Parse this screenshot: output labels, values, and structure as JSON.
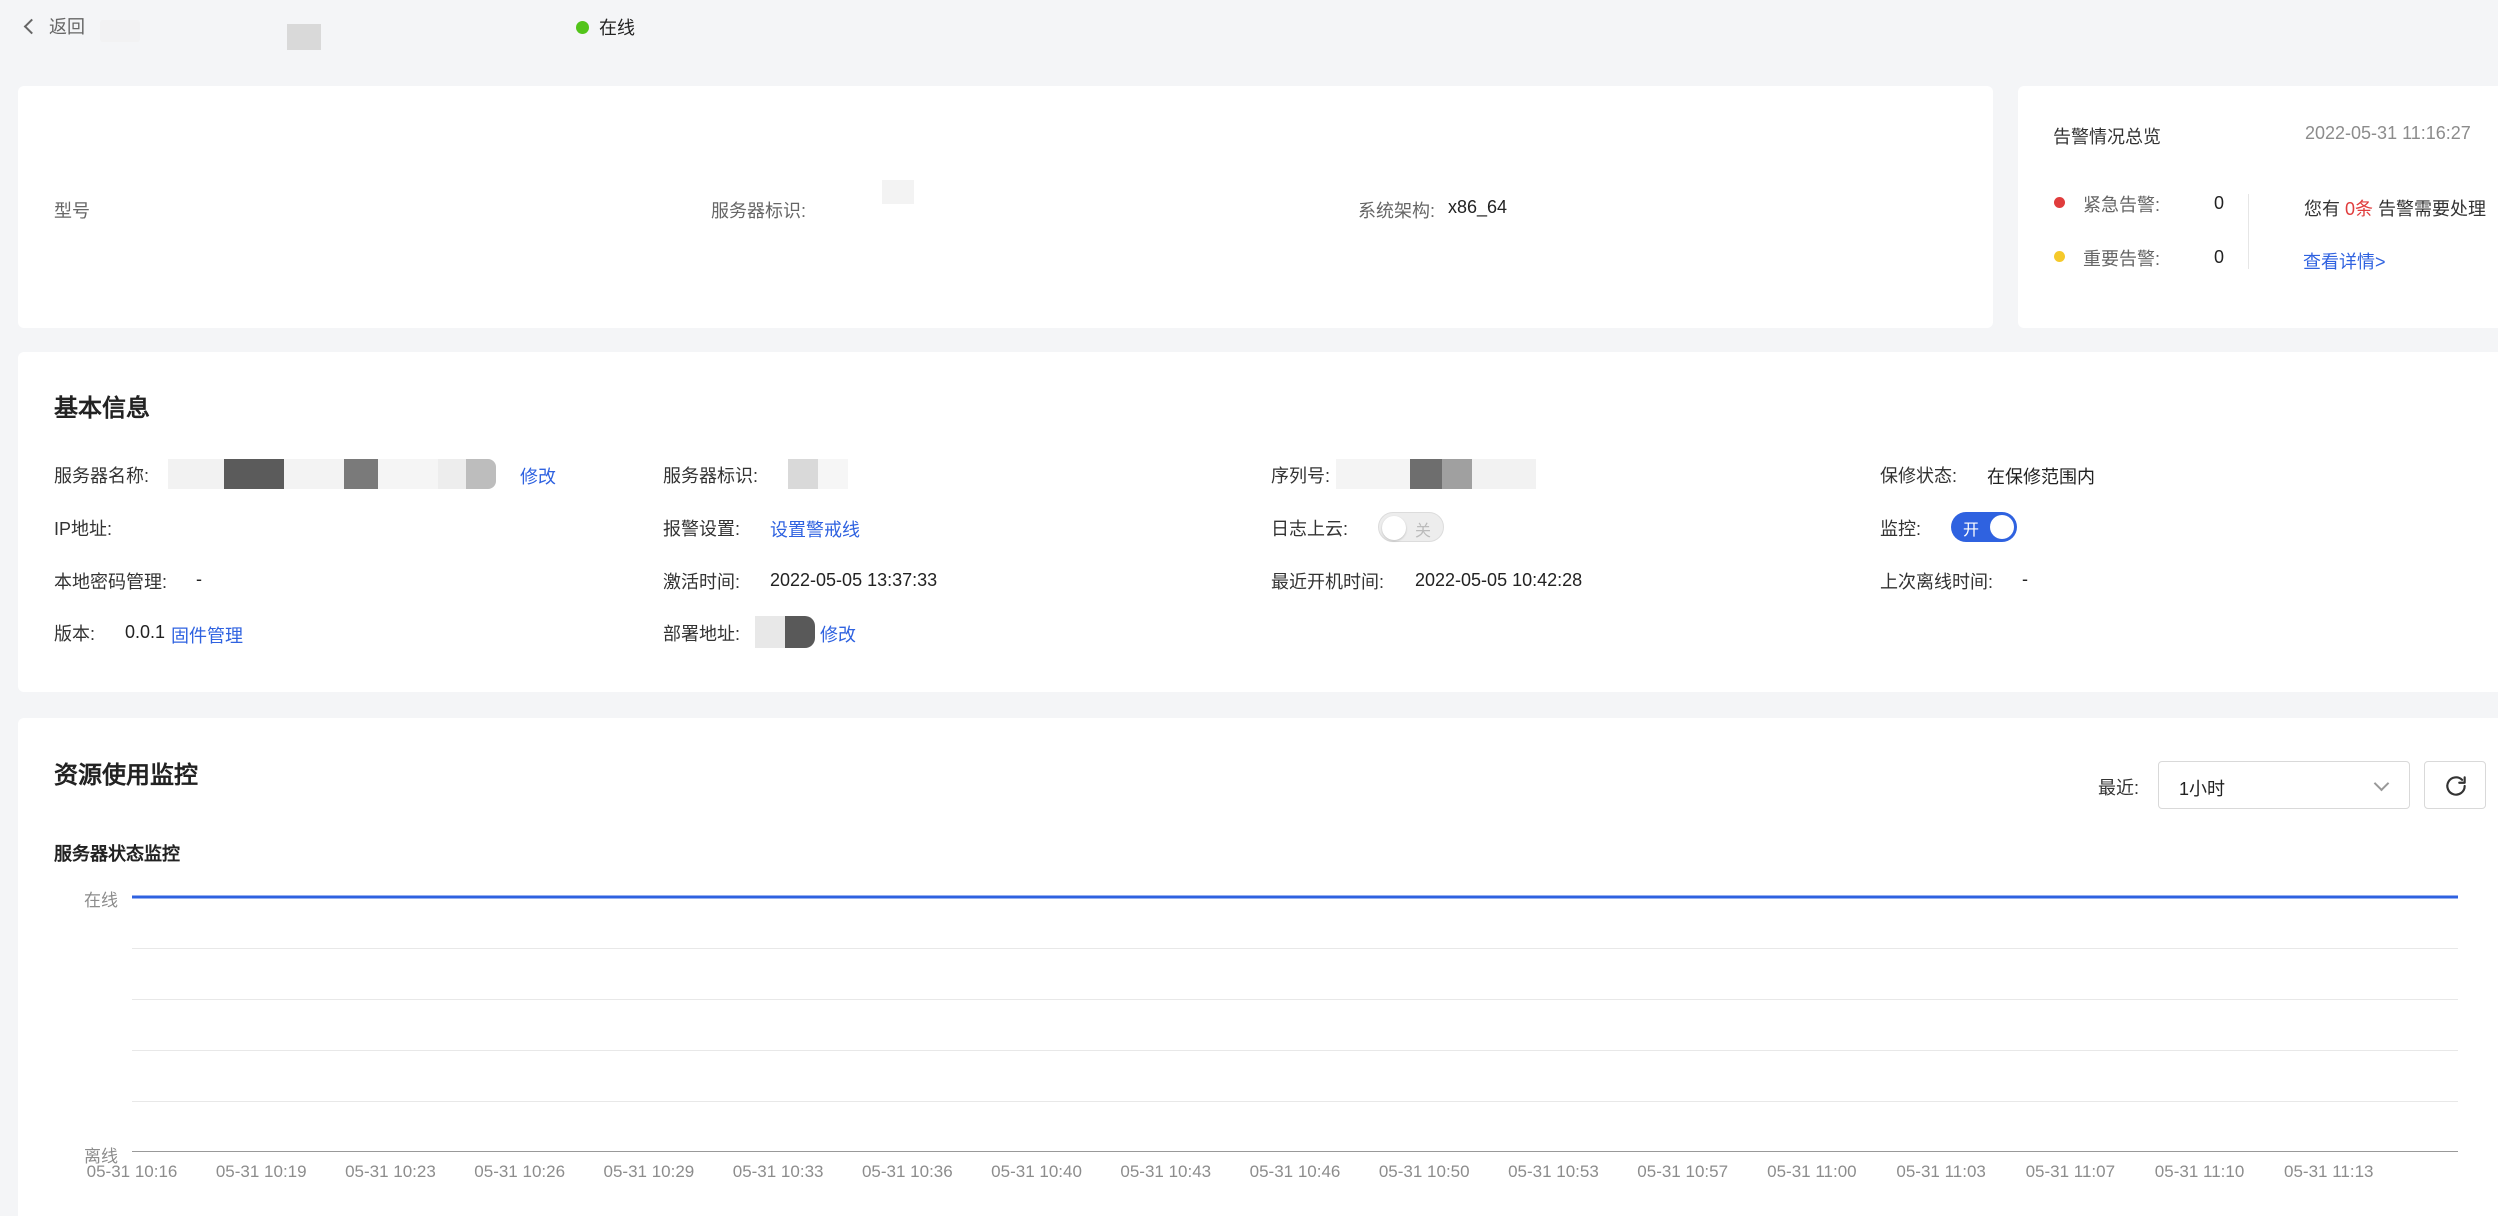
{
  "header": {
    "back_label": "返回",
    "status": "在线",
    "status_color": "#52c41a"
  },
  "summary": {
    "model_label": "型号",
    "server_id_label": "服务器标识:",
    "arch_label": "系统架构:",
    "arch_value": "x86_64"
  },
  "alarm": {
    "title": "告警情况总览",
    "timestamp": "2022-05-31 11:16:27",
    "critical_label": "紧急告警:",
    "critical_count": "0",
    "critical_color": "#e03c3c",
    "major_label": "重要告警:",
    "major_count": "0",
    "major_color": "#f5c92a",
    "notice_prefix": "您有",
    "notice_count": "0条",
    "notice_suffix": "告警需要处理",
    "details_link": "查看详情>"
  },
  "basic": {
    "title": "基本信息",
    "server_name_label": "服务器名称:",
    "edit_label": "修改",
    "ip_label": "IP地址:",
    "local_pwd_label": "本地密码管理:",
    "local_pwd_value": "-",
    "version_label": "版本:",
    "version_value": "0.0.1",
    "firmware_link": "固件管理",
    "server_id_label": "服务器标识:",
    "alarm_setting_label": "报警设置:",
    "alarm_setting_link": "设置警戒线",
    "activate_label": "激活时间:",
    "activate_value": "2022-05-05 13:37:33",
    "deploy_label": "部署地址:",
    "deploy_edit_label": "修改",
    "serial_label": "序列号:",
    "log_cloud_label": "日志上云:",
    "log_cloud_toggle": "关",
    "boot_label": "最近开机时间:",
    "boot_value": "2022-05-05 10:42:28",
    "warranty_label": "保修状态:",
    "warranty_value": "在保修范围内",
    "monitor_label": "监控:",
    "monitor_toggle": "开",
    "offline_label": "上次离线时间:",
    "offline_value": "-",
    "accent_color": "#2f62e0"
  },
  "resource": {
    "title": "资源使用监控",
    "recent_label": "最近:",
    "range_value": "1小时",
    "chart_title": "服务器状态监控"
  },
  "chart_data": {
    "type": "line",
    "title": "服务器状态监控",
    "categories": [
      "在线",
      "离线"
    ],
    "x": [
      "05-31 10:16",
      "05-31 10:19",
      "05-31 10:23",
      "05-31 10:26",
      "05-31 10:29",
      "05-31 10:33",
      "05-31 10:36",
      "05-31 10:40",
      "05-31 10:43",
      "05-31 10:46",
      "05-31 10:50",
      "05-31 10:53",
      "05-31 10:57",
      "05-31 11:00",
      "05-31 11:03",
      "05-31 11:07",
      "05-31 11:10",
      "05-31 11:13"
    ],
    "series": [
      {
        "values": [
          "在线",
          "在线",
          "在线",
          "在线",
          "在线",
          "在线",
          "在线",
          "在线",
          "在线",
          "在线",
          "在线",
          "在线",
          "在线",
          "在线",
          "在线",
          "在线",
          "在线",
          "在线"
        ]
      }
    ],
    "line_color": "#2f62e0",
    "grid": true
  }
}
